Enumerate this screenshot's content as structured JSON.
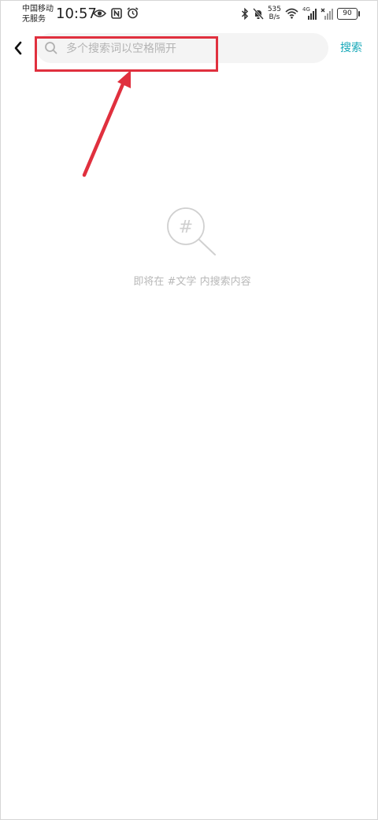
{
  "status_bar": {
    "carrier_line1": "中国移动",
    "carrier_line2": "无服务",
    "time": "10:57",
    "speed_value": "535",
    "speed_unit": "B/s",
    "network_type": "4G",
    "battery_level": "90"
  },
  "header": {
    "search_placeholder": "多个搜索词以空格隔开",
    "search_value": "",
    "search_button": "搜索"
  },
  "empty_state": {
    "icon_symbol": "#",
    "message": "即将在 #文学 内搜索内容"
  },
  "colors": {
    "accent": "#16a8b8",
    "annotation": "#e0303e",
    "placeholder": "#b4b4b4",
    "empty_state": "#b8b8b8"
  },
  "icons": [
    "eye-icon",
    "nfc-icon",
    "alarm-icon",
    "bluetooth-icon",
    "mute-bell-icon",
    "wifi-icon",
    "signal-icon",
    "no-signal-icon",
    "battery-icon",
    "back-arrow-icon",
    "search-icon",
    "hashtag-search-icon"
  ]
}
